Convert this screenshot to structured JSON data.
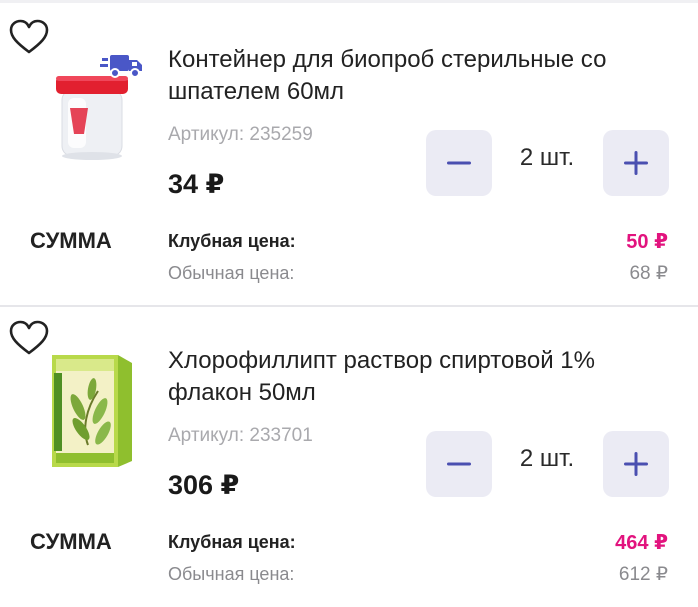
{
  "cart": {
    "items": [
      {
        "title_line1": "Контейнер для биопроб стерильные со",
        "title_line2": "шпателем 60мл",
        "sku": "Артикул: 235259",
        "price": "34 ₽",
        "quantity": "2 шт.",
        "sum_label": "СУММА",
        "club_label": "Клубная цена:",
        "club_price": "50 ₽",
        "regular_label": "Обычная цена:",
        "regular_price": "68 ₽",
        "image_icon": "specimen-container-image",
        "badge_icon": "delivery-truck-icon"
      },
      {
        "title_line1": "Хлорофиллипт раствор спиртовой 1%",
        "title_line2": "флакон 50мл",
        "sku": "Артикул: 233701",
        "price": "306 ₽",
        "quantity": "2 шт.",
        "sum_label": "СУММА",
        "club_label": "Клубная цена:",
        "club_price": "464 ₽",
        "regular_label": "Обычная цена:",
        "regular_price": "612 ₽",
        "image_icon": "chlorophyllipt-box-image"
      }
    ]
  },
  "colors": {
    "accent": "#e2137e",
    "button_bg": "#ebebf4",
    "button_icon": "#4a4fb0",
    "delivery_icon": "#4a57c7",
    "muted": "#a9a9ad"
  },
  "icons": {
    "favorite": "heart-outline-icon",
    "decrease": "minus-icon",
    "increase": "plus-icon"
  }
}
